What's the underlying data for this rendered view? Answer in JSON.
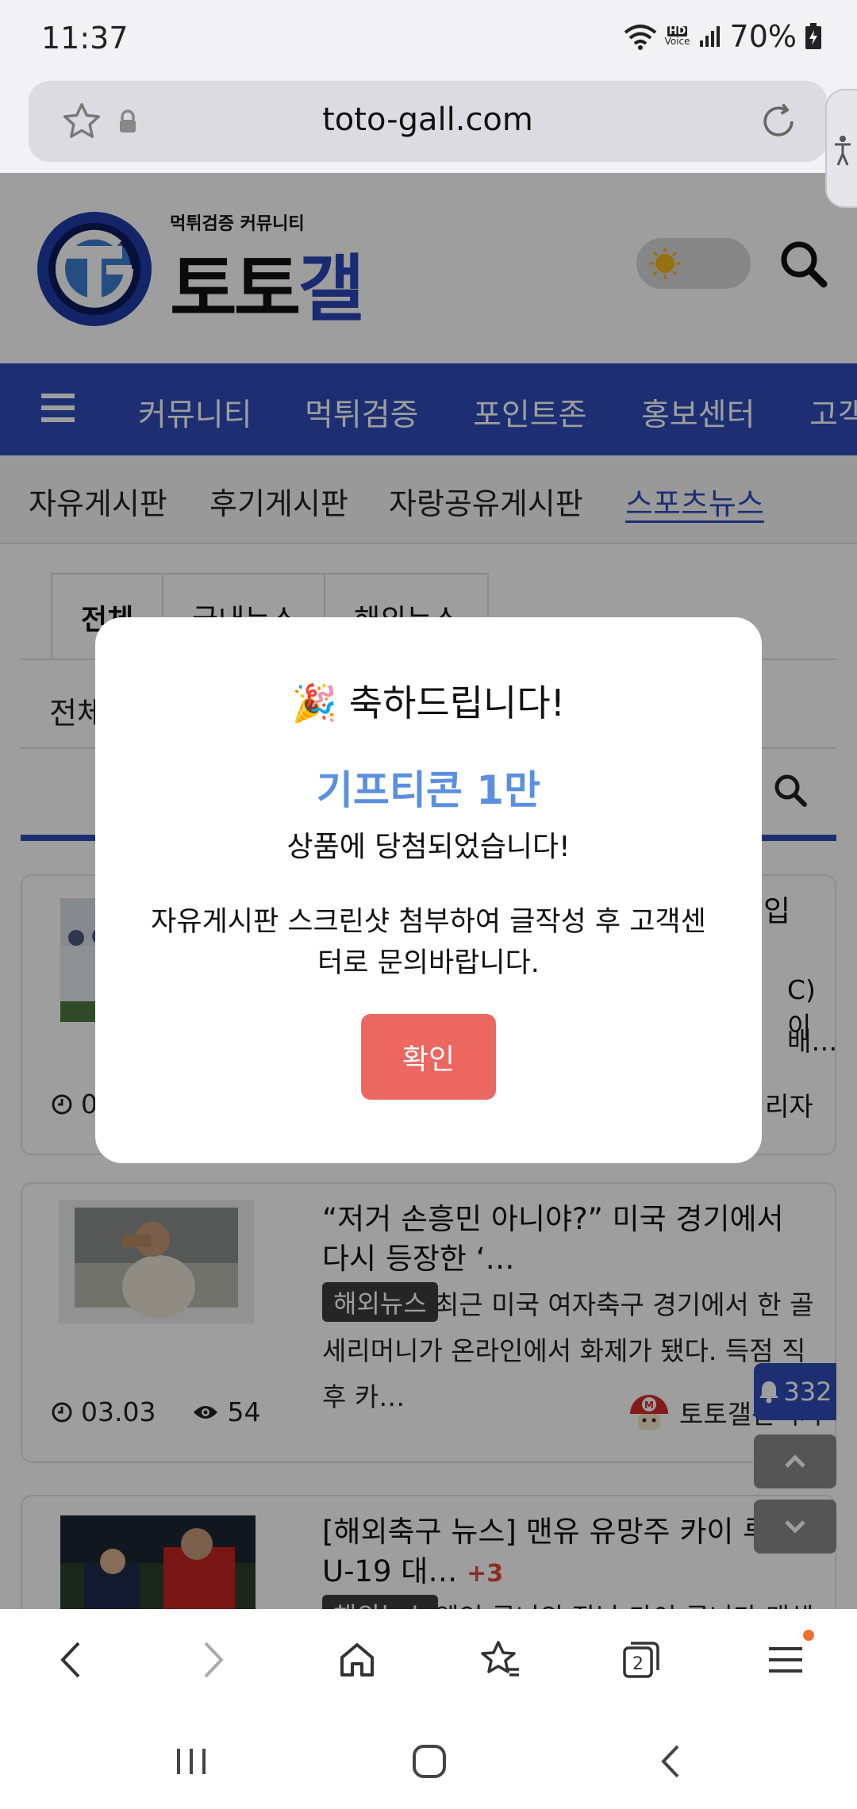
{
  "status_bar": {
    "time": "11:37",
    "battery": "70%",
    "hd_label": "HD",
    "voice_label": "Voice"
  },
  "browser": {
    "url": "toto-gall.com",
    "tab_count": "2"
  },
  "site": {
    "logo_subtitle": "먹튀검증 커뮤니티",
    "logo_text_black": "토토",
    "logo_text_blue": "갤",
    "main_nav": [
      "커뮤니티",
      "먹튀검증",
      "포인트존",
      "홍보센터",
      "고객"
    ],
    "sub_nav": [
      "자유게시판",
      "후기게시판",
      "자랑공유게시판",
      "스포츠뉴스"
    ],
    "tabs": [
      "전체",
      "국내뉴스",
      "해외뉴스"
    ],
    "filter_label": "전체",
    "posts": [
      {
        "title_tail": "입",
        "excerpt_tail_1": "C)이",
        "excerpt_tail_2": "배…",
        "date": "0",
        "author_tail": "리자"
      },
      {
        "title": "“저거 손흥민 아니야?” 미국 경기에서 다시 등장한 ‘…",
        "badge": "해외뉴스",
        "excerpt": "최근 미국 여자축구 경기에서 한 골 세리머니가 온라인에서 화제가 됐다. 득점 직후 카…",
        "date": "03.03",
        "views": "54",
        "author": "토토갤관리자"
      },
      {
        "title": "[해외축구 뉴스] 맨유 유망주 카이 루니, U-19 대…",
        "comment_count": "+3",
        "badge": "해외뉴스",
        "excerpt": "웨인 루니의 장남 카이 루니가 맨체스…"
      }
    ],
    "notification_count": "332"
  },
  "modal": {
    "emoji": "🎉",
    "title": "축하드립니다!",
    "prize": "기프티콘 1만",
    "line1": "상품에 당첨되었습니다!",
    "line2": "자유게시판 스크린샷 첨부하여 글작성 후 고객센터로 문의바랍니다.",
    "ok_label": "확인"
  },
  "colors": {
    "nav_blue": "#2f4db8",
    "prize_blue": "#5b8fdf",
    "ok_red": "#ec6760"
  }
}
